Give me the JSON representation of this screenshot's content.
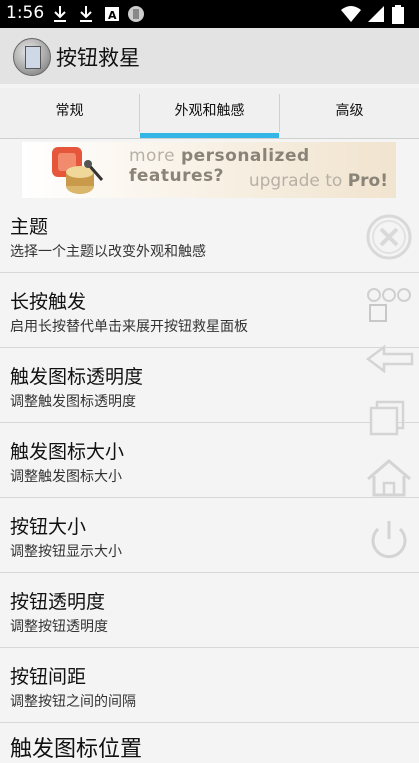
{
  "status_bar": {
    "time": "1:56",
    "left_icons": [
      "download-icon",
      "download-icon",
      "letter-a-icon",
      "circle-app-icon"
    ],
    "right_icons": [
      "wifi-icon",
      "signal-icon",
      "battery-icon"
    ]
  },
  "app_bar": {
    "title": "按钮救星",
    "icon": "app-logo"
  },
  "tabs": [
    {
      "label": "常规",
      "active": false
    },
    {
      "label": "外观和触感",
      "active": true
    },
    {
      "label": "高级",
      "active": false
    }
  ],
  "accent_color": "#33b5e5",
  "banner": {
    "line1_prefix": "more ",
    "line1_strong": "personalized features?",
    "line2_prefix": "upgrade to ",
    "line2_strong": "Pro!"
  },
  "preferences": [
    {
      "title": "主题",
      "summary": "选择一个主题以改变外观和触感"
    },
    {
      "title": "长按触发",
      "summary": "启用长按替代单击来展开按钮救星面板"
    },
    {
      "title": "触发图标透明度",
      "summary": "调整触发图标透明度"
    },
    {
      "title": "触发图标大小",
      "summary": "调整触发图标大小"
    },
    {
      "title": "按钮大小",
      "summary": "调整按钮显示大小"
    },
    {
      "title": "按钮透明度",
      "summary": "调整按钮透明度"
    },
    {
      "title": "按钮间距",
      "summary": "调整按钮之间的间隔"
    }
  ],
  "partial_item": {
    "title": "触发图标位置"
  },
  "floating_panel": {
    "buttons": [
      "close-icon",
      "menu-icon",
      "back-icon",
      "recent-apps-icon",
      "home-icon",
      "power-icon"
    ]
  }
}
